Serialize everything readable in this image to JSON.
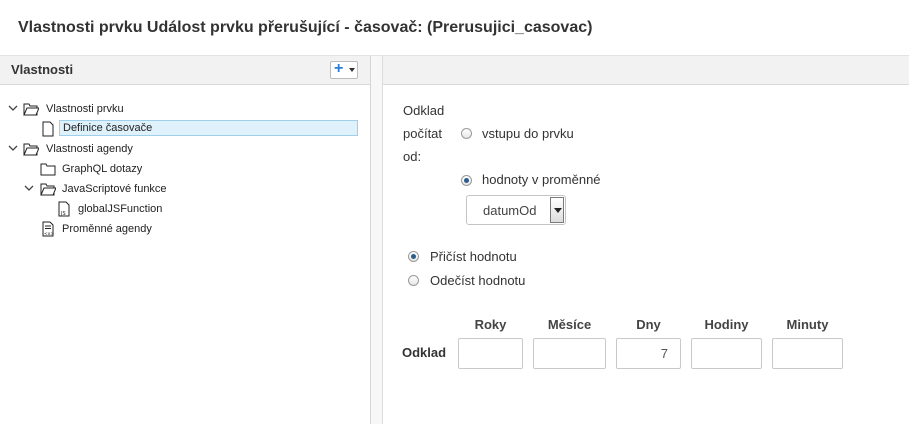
{
  "dialog": {
    "title": "Vlastnosti prvku Událost prvku přerušující - časovač: (Prerusujici_casovac)"
  },
  "left_panel": {
    "title": "Vlastnosti",
    "add_label": "+",
    "tree": [
      {
        "label": "Vlastnosti prvku"
      },
      {
        "label": "Definice časovače"
      },
      {
        "label": "Vlastnosti agendy"
      },
      {
        "label": "GraphQL dotazy"
      },
      {
        "label": "JavaScriptové funkce"
      },
      {
        "label": "globalJSFunction"
      },
      {
        "label": "Proměnné agendy"
      }
    ]
  },
  "form": {
    "delay_label_line1": "Odklad",
    "delay_label_line2": "počítat",
    "delay_label_line3": "od:",
    "option_entry": "vstupu do prvku",
    "option_variable": "hodnoty v proměnné",
    "variable_select": "datumOd",
    "option_add": "Přičíst hodnotu",
    "option_subtract": "Odečíst hodnotu",
    "columns": [
      "Roky",
      "Měsíce",
      "Dny",
      "Hodiny",
      "Minuty"
    ],
    "row_label": "Odklad",
    "values": {
      "roky": "",
      "mesice": "",
      "dny": "7",
      "hodiny": "",
      "minuty": ""
    }
  }
}
